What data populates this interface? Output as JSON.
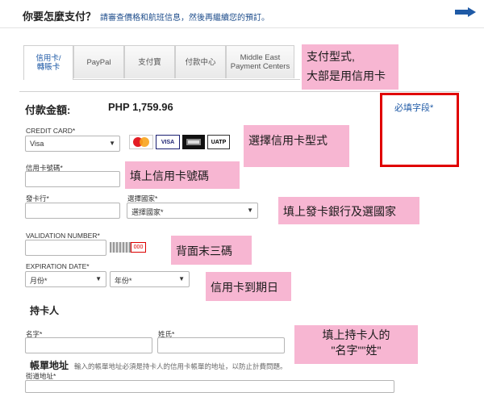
{
  "header": {
    "question": "你要怎麼支付？",
    "subtitle": "請審查價格和航班信息，然後再繼續您的預訂。"
  },
  "tabs": [
    {
      "label": "信用卡/\n轉賬卡",
      "active": true
    },
    {
      "label": "PayPal",
      "active": false
    },
    {
      "label": "支付寶",
      "active": false
    },
    {
      "label": "付款中心",
      "active": false
    },
    {
      "label": "Middle East\nPayment Centers",
      "active": false
    }
  ],
  "notes": {
    "payment_type_line1": "支付型式,",
    "payment_type_line2": "大部是用信用卡",
    "choose_card": "選擇信用卡型式",
    "fill_card_number": "填上信用卡號碼",
    "fill_bank_country": "填上發卡銀行及選國家",
    "back_three_digits": "背面末三碼",
    "expiry": "信用卡到期日",
    "holder_name_line1": "填上持卡人的",
    "holder_name_line2": "\"名字\"\"姓\""
  },
  "payment": {
    "amount_label": "付款金額:",
    "amount_value": "PHP 1,759.96",
    "required_label": "必填字段*"
  },
  "form": {
    "credit_card_label": "CREDIT CARD*",
    "credit_card_value": "Visa",
    "card_number_label": "信用卡號碼*",
    "issuer_label": "發卡行*",
    "country_label": "選擇國家*",
    "country_value": "選擇國家*",
    "validation_label": "VALIDATION NUMBER*",
    "cvv_sample": "000",
    "expiration_label": "EXPIRATION DATE*",
    "month_value": "月份*",
    "year_value": "年份*",
    "cardholder_heading": "持卡人",
    "first_name_label": "名字*",
    "last_name_label": "姓氏*",
    "billing_heading": "帳單地址",
    "billing_note": "輸入的帳單地址必須是持卡人的信用卡帳單的地址，以防止計費問題。",
    "street_label": "街道地址*"
  },
  "card_logos": [
    {
      "name": "MasterCard",
      "color": "#e31c24"
    },
    {
      "name": "VISA",
      "color": "#1a1f71"
    },
    {
      "name": "AMEX",
      "color": "#000000"
    },
    {
      "name": "UATP",
      "color": "#000000"
    }
  ],
  "colors": {
    "note_bg": "#f7b6d2",
    "link_blue": "#1f5aa6",
    "required_box": "#e00000",
    "arrow_blue": "#1f5aa6"
  }
}
